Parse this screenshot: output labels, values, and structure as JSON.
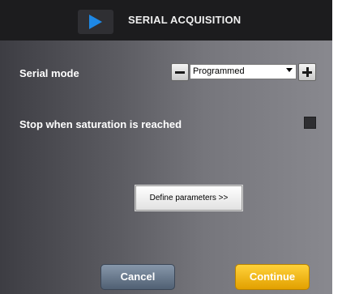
{
  "dialog": {
    "title": "SERIAL ACQUISITION",
    "title_icon": "play-icon",
    "accent_icon_color": "#1e88e5"
  },
  "serial_mode": {
    "label": "Serial mode",
    "selected_value": "Programmed",
    "minus_icon": "minus-icon",
    "plus_icon": "plus-icon"
  },
  "saturation": {
    "label": "Stop when saturation is reached",
    "checked": false
  },
  "define_parameters": {
    "label": "Define parameters >>"
  },
  "footer": {
    "cancel_label": "Cancel",
    "continue_label": "Continue",
    "continue_color": "#f5b400",
    "cancel_color": "#6b7b8e"
  }
}
